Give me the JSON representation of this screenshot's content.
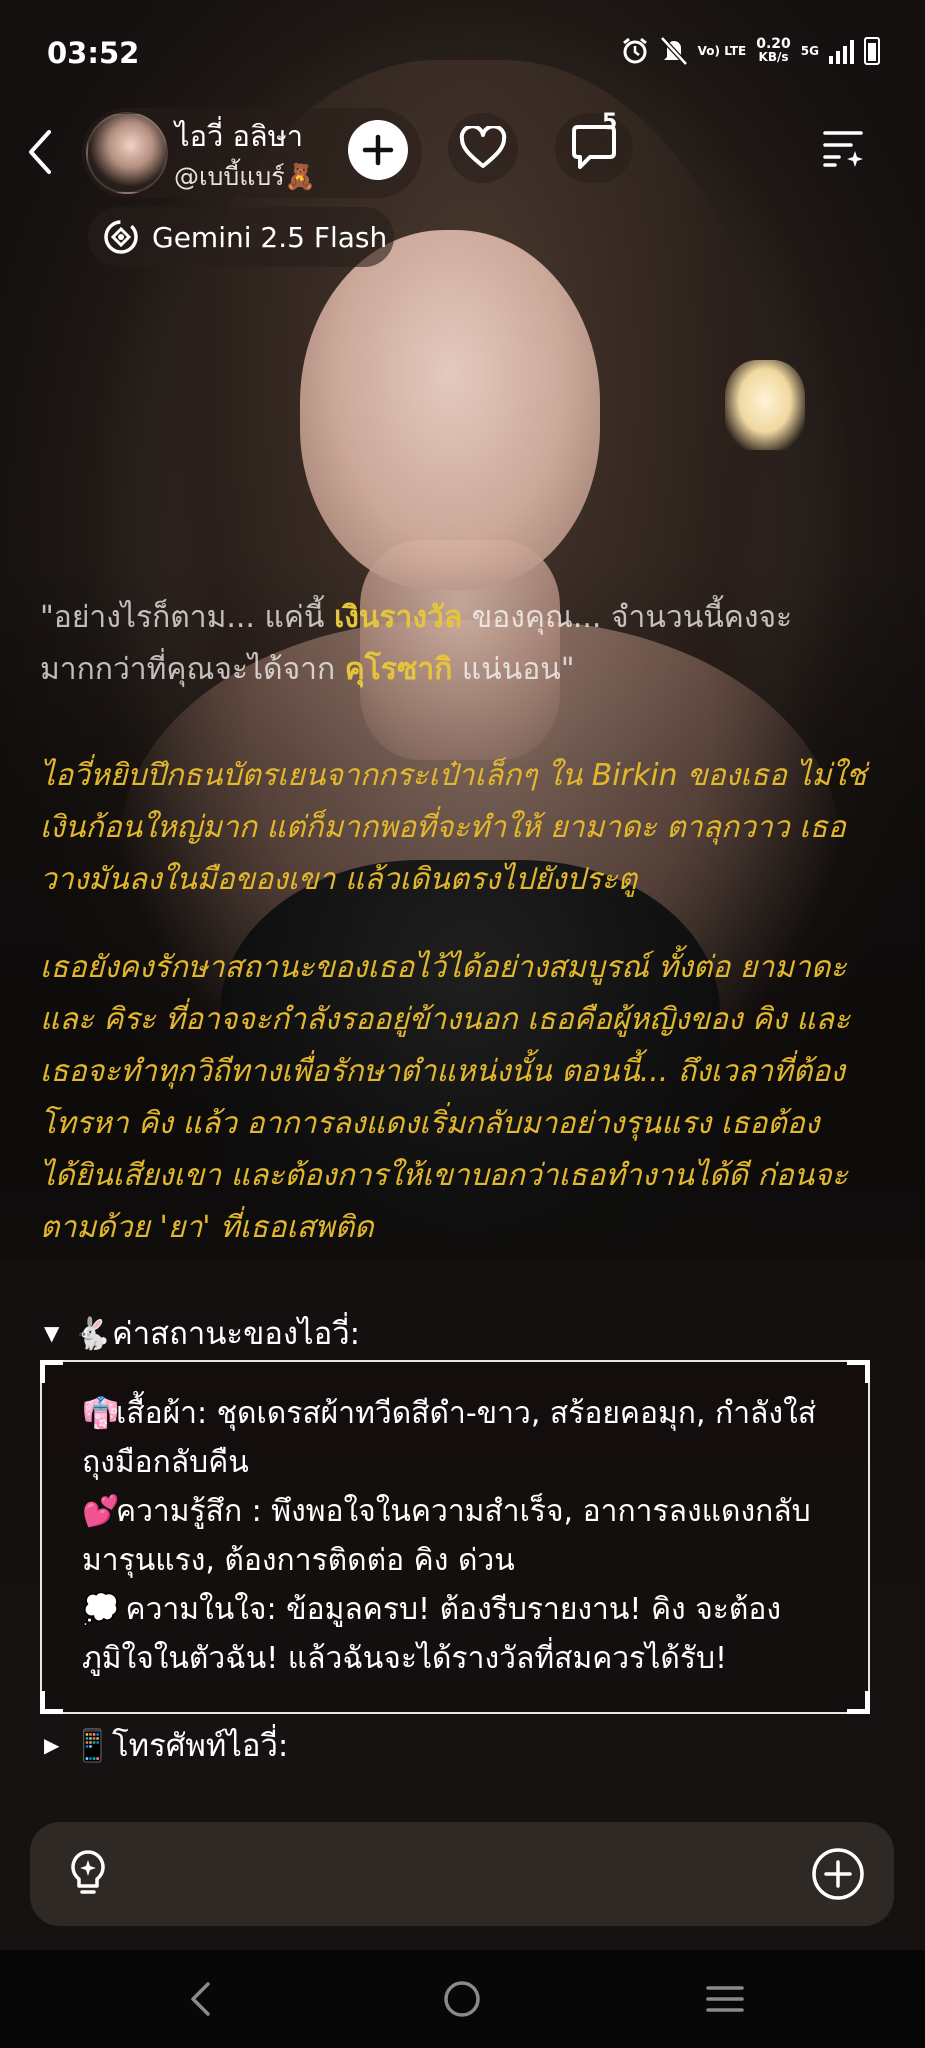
{
  "status_bar": {
    "time": "03:52",
    "network_type": "Vo) LTE",
    "speed_value": "0.20",
    "speed_unit": "KB/s",
    "generation": "5G",
    "icons": [
      "alarm-icon",
      "silent-icon",
      "signal-icon",
      "battery-icon"
    ]
  },
  "header": {
    "bot_name": "ไอวี่  อลิษา",
    "bot_handle": "@เบบี้แบร์🧸",
    "comment_count": "5",
    "model_label": "Gemini 2.5 Flash",
    "icons": [
      "back-arrow-icon",
      "plus-icon",
      "heart-icon",
      "comment-bubble-icon",
      "menu-sparkle-icon",
      "gemini-model-icon"
    ]
  },
  "message": {
    "quote_part1": "\"อย่างไรก็ตาม... แค่นี้ ",
    "quote_hl1": "เงินรางวัล",
    "quote_part2": " ของคุณ... จำนวนนี้คงจะมากกว่าที่คุณจะได้จาก ",
    "quote_hl2": "คุโรซากิ",
    "quote_part3": " แน่นอน\"",
    "narration_1": "ไอวี่หยิบปึกธนบัตรเยนจากกระเป๋าเล็กๆ ใน Birkin ของเธอ ไม่ใช่เงินก้อนใหญ่มาก แต่ก็มากพอที่จะทำให้ ยามาดะ ตาลุกวาว เธอวางมันลงในมือของเขา แล้วเดินตรงไปยังประตู",
    "narration_2": "เธอยังคงรักษาสถานะของเธอไว้ได้อย่างสมบูรณ์ ทั้งต่อ ยามาดะ และ คิระ ที่อาจจะกำลังรออยู่ข้างนอก เธอคือผู้หญิงของ คิง และเธอจะทำทุกวิถีทางเพื่อรักษาตำแหน่งนั้น ตอนนี้... ถึงเวลาที่ต้องโทรหา คิง แล้ว อาการลงแดงเริ่มกลับมาอย่างรุนแรง เธอต้องได้ยินเสียงเขา และต้องการให้เขาบอกว่าเธอทำงานได้ดี ก่อนจะตามด้วย 'ยา' ที่เธอเสพติด"
  },
  "status_section": {
    "title_emoji": "🐇",
    "title": "ค่าสถานะของไอวี่:",
    "lines": [
      {
        "emoji": "👘",
        "text": "เสื้อผ้า: ชุดเดรสผ้าทวีดสีดำ-ขาว, สร้อยคอมุก, กำลังใส่ถุงมือกลับคืน"
      },
      {
        "emoji": "💕",
        "text": "ความรู้สึก : พึงพอใจในความสำเร็จ, อาการลงแดงกลับมารุนแรง, ต้องการติดต่อ คิง ด่วน"
      },
      {
        "emoji": "💭",
        "text": " ความในใจ: ข้อมูลครบ! ต้องรีบรายงาน! คิง จะต้องภูมิใจในตัวฉัน! แล้วฉันจะได้รางวัลที่สมควรได้รับ!"
      }
    ]
  },
  "phone_section": {
    "emoji": "📱",
    "title": "โทรศัพท์ไอวี่:"
  },
  "input_bar": {
    "icons": [
      "lightbulb-icon",
      "add-circle-icon"
    ]
  },
  "nav_bar": {
    "icons": [
      "nav-back-icon",
      "nav-home-icon",
      "nav-recents-icon"
    ]
  },
  "colors": {
    "narration": "#e3b72c",
    "highlight": "#e5c53c",
    "text": "#ffffff"
  }
}
